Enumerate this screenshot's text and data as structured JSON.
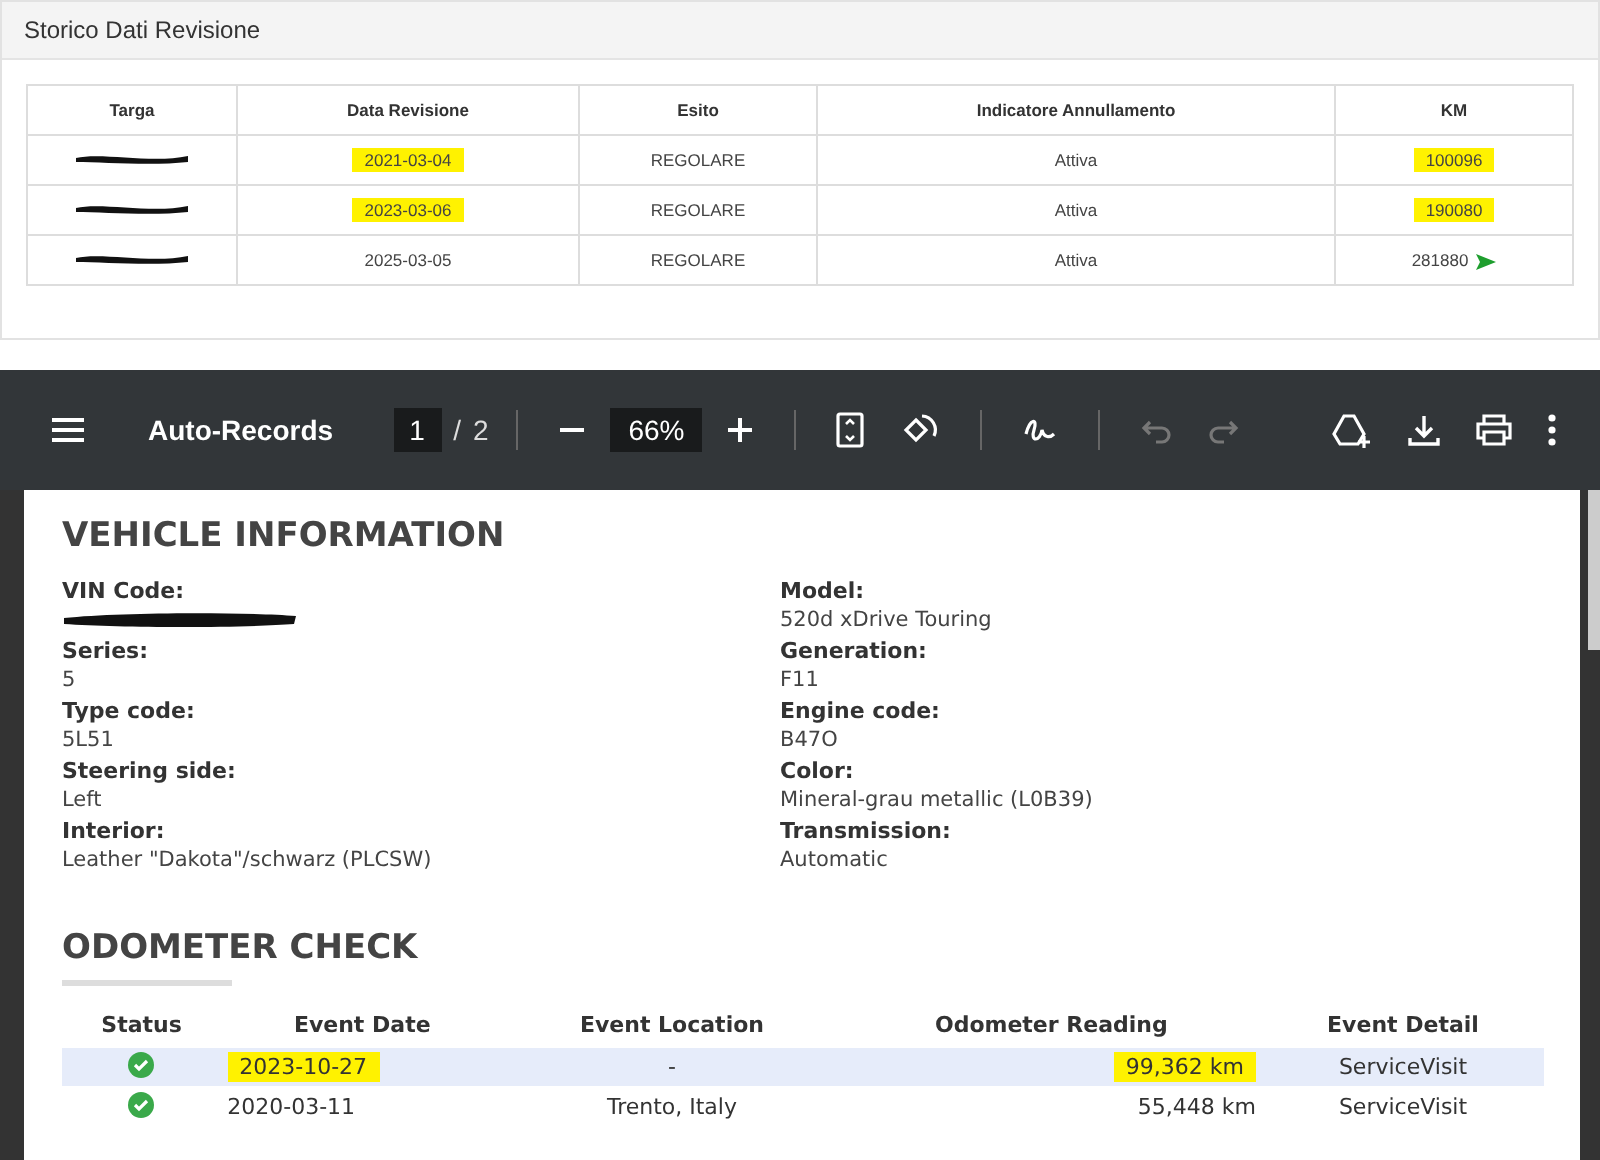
{
  "panel": {
    "title": "Storico Dati Revisione"
  },
  "table": {
    "columns": [
      "Targa",
      "Data Revisione",
      "Esito",
      "Indicatore Annullamento",
      "KM"
    ],
    "rows": [
      {
        "date": "2021-03-04",
        "date_highlighted": true,
        "result": "REGOLARE",
        "status": "Attiva",
        "km": "100096",
        "km_highlighted": true,
        "flag": false
      },
      {
        "date": "2023-03-06",
        "date_highlighted": true,
        "result": "REGOLARE",
        "status": "Attiva",
        "km": "190080",
        "km_highlighted": true,
        "flag": false
      },
      {
        "date": "2025-03-05",
        "date_highlighted": false,
        "result": "REGOLARE",
        "status": "Attiva",
        "km": "281880",
        "km_highlighted": false,
        "flag": true
      }
    ]
  },
  "viewer": {
    "title": "Auto-Records",
    "page": "1",
    "separator": "/",
    "pages": "2",
    "zoom": "66%"
  },
  "vehicle": {
    "heading": "VEHICLE INFORMATION",
    "left": [
      {
        "label": "VIN Code:"
      },
      {
        "label": "Series:",
        "value": "5"
      },
      {
        "label": "Type code:",
        "value": "5L51"
      },
      {
        "label": "Steering side:",
        "value": "Left"
      },
      {
        "label": "Interior:",
        "value": "Leather \"Dakota\"/schwarz (PLCSW)"
      }
    ],
    "right": [
      {
        "label": "Model:",
        "value": "520d xDrive Touring"
      },
      {
        "label": "Generation:",
        "value": "F11"
      },
      {
        "label": "Engine code:",
        "value": "B47O"
      },
      {
        "label": "Color:",
        "value": "Mineral-grau metallic (L0B39)"
      },
      {
        "label": "Transmission:",
        "value": "Automatic"
      }
    ]
  },
  "odometer": {
    "heading": "ODOMETER CHECK",
    "columns": [
      "Status",
      "Event Date",
      "Event Location",
      "Odometer Reading",
      "Event Detail"
    ],
    "rows": [
      {
        "ok": true,
        "selected": true,
        "date": "2023-10-27",
        "location": "-",
        "reading": "99,362 km",
        "detail": "ServiceVisit",
        "highlighted": true
      },
      {
        "ok": true,
        "selected": false,
        "date": "2020-03-11",
        "location": "Trento, Italy",
        "reading": "55,448 km",
        "detail": "ServiceVisit",
        "highlighted": false
      }
    ]
  }
}
